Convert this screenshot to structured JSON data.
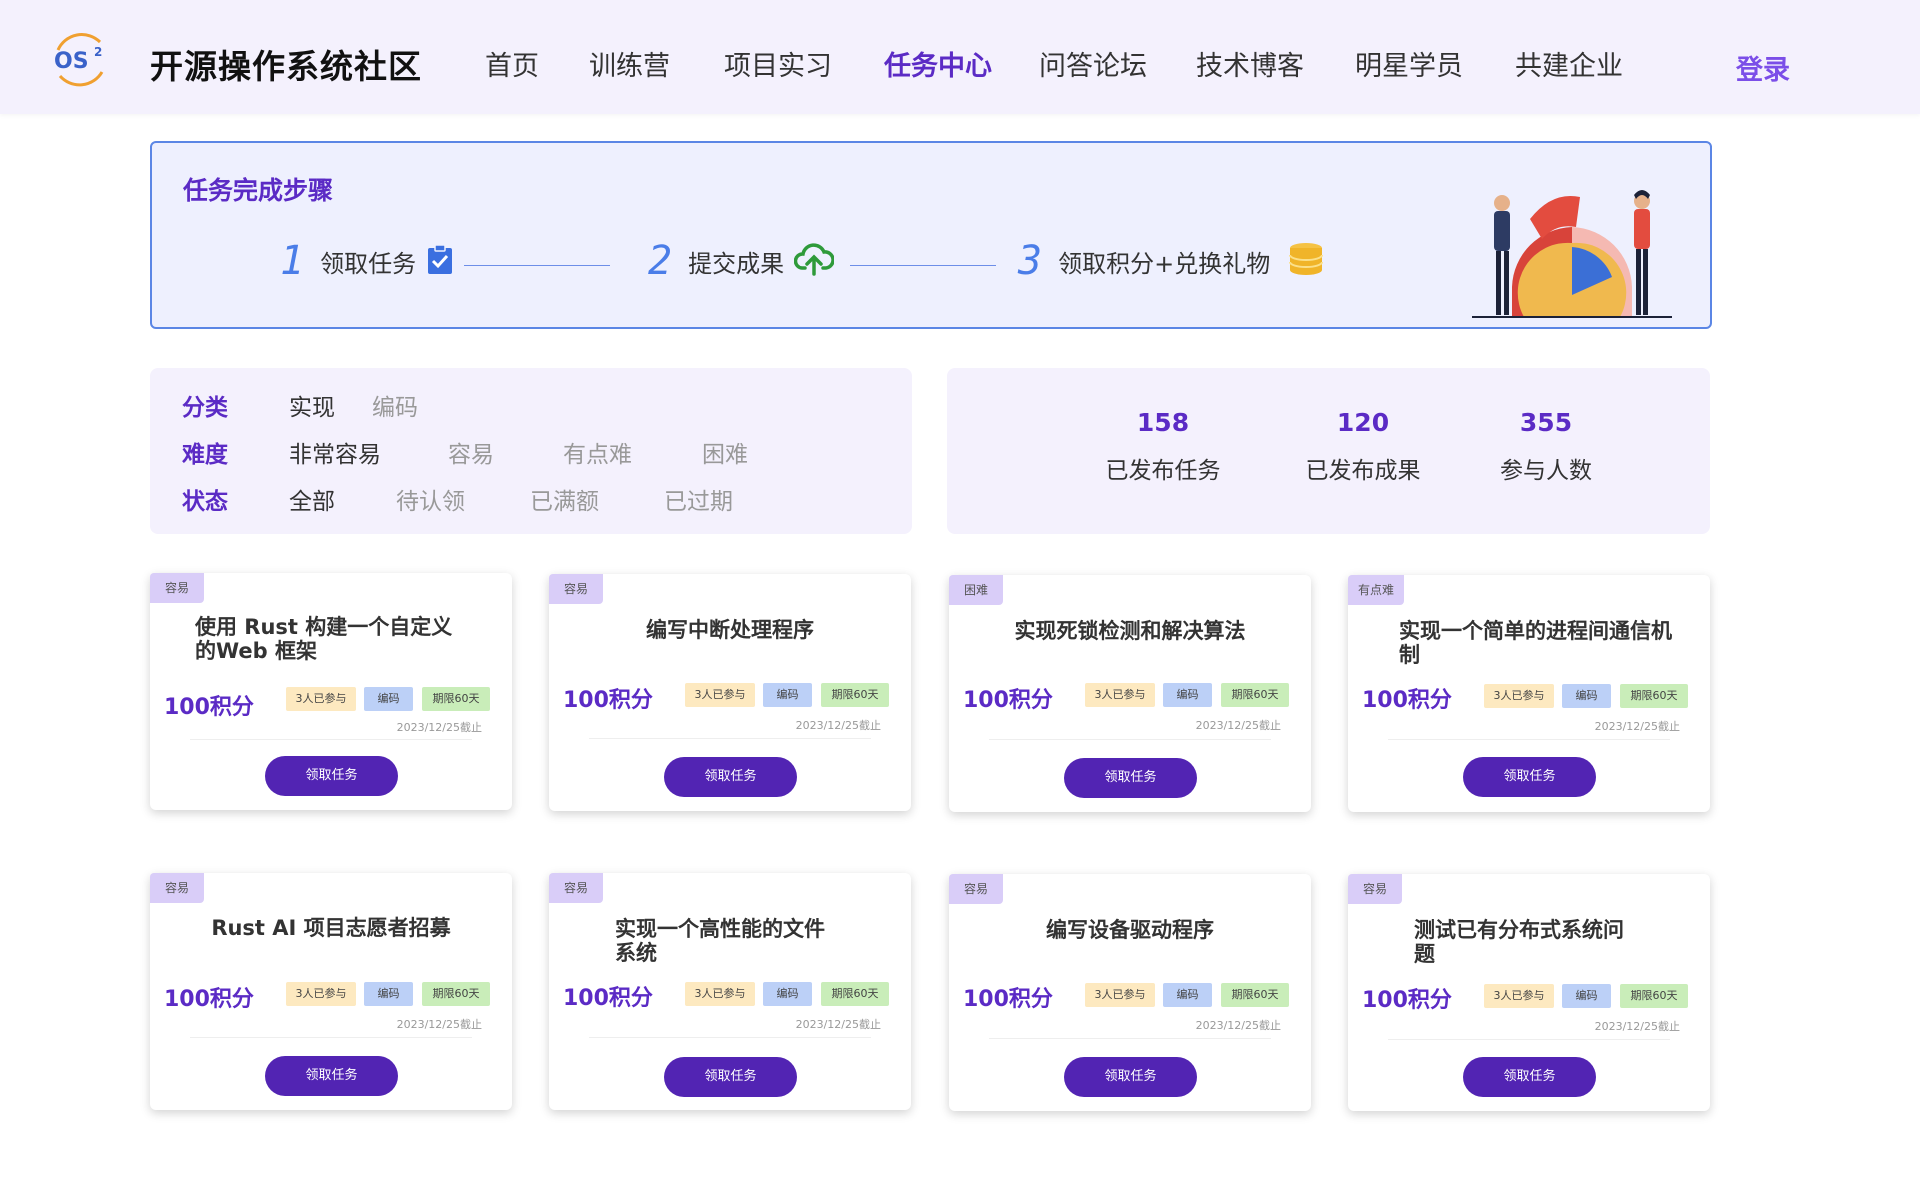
{
  "header": {
    "site_title": "开源操作系统社区",
    "logo_text": "OS²",
    "nav": [
      "首页",
      "训练营",
      "项目实习",
      "任务中心",
      "问答论坛",
      "技术博客",
      "明星学员",
      "共建企业"
    ],
    "active_nav": "任务中心",
    "login": "登录"
  },
  "steps": {
    "title": "任务完成步骤",
    "items": [
      {
        "num": "1",
        "label": "领取任务",
        "icon": "clipboard-check-icon"
      },
      {
        "num": "2",
        "label": "提交成果",
        "icon": "cloud-upload-icon"
      },
      {
        "num": "3",
        "label": "领取积分+兑换礼物",
        "icon": "coins-stack-icon"
      }
    ]
  },
  "filters": {
    "category": {
      "label": "分类",
      "options": [
        "实现",
        "编码"
      ],
      "selected": "实现"
    },
    "difficulty": {
      "label": "难度",
      "options": [
        "非常容易",
        "容易",
        "有点难",
        "困难"
      ],
      "selected": "非常容易"
    },
    "status": {
      "label": "状态",
      "options": [
        "全部",
        "待认领",
        "已满额",
        "已过期"
      ],
      "selected": "全部"
    }
  },
  "stats": [
    {
      "value": "158",
      "label": "已发布任务"
    },
    {
      "value": "120",
      "label": "已发布成果"
    },
    {
      "value": "355",
      "label": "参与人数"
    }
  ],
  "tasks": [
    {
      "difficulty": "容易",
      "title": "使用 Rust 构建一个自定义的Web 框架",
      "points": "100积分",
      "participants": "3人已参与",
      "type": "编码",
      "limit": "期限60天",
      "deadline": "2023/12/25截止",
      "button": "领取任务"
    },
    {
      "difficulty": "容易",
      "title": "编写中断处理程序",
      "points": "100积分",
      "participants": "3人已参与",
      "type": "编码",
      "limit": "期限60天",
      "deadline": "2023/12/25截止",
      "button": "领取任务"
    },
    {
      "difficulty": "困难",
      "title": "实现死锁检测和解决算法",
      "points": "100积分",
      "participants": "3人已参与",
      "type": "编码",
      "limit": "期限60天",
      "deadline": "2023/12/25截止",
      "button": "领取任务"
    },
    {
      "difficulty": "有点难",
      "title": "实现一个简单的进程间通信机制",
      "points": "100积分",
      "participants": "3人已参与",
      "type": "编码",
      "limit": "期限60天",
      "deadline": "2023/12/25截止",
      "button": "领取任务"
    },
    {
      "difficulty": "容易",
      "title": "Rust AI 项目志愿者招募",
      "points": "100积分",
      "participants": "3人已参与",
      "type": "编码",
      "limit": "期限60天",
      "deadline": "2023/12/25截止",
      "button": "领取任务"
    },
    {
      "difficulty": "容易",
      "title": "实现一个高性能的文件系统",
      "points": "100积分",
      "participants": "3人已参与",
      "type": "编码",
      "limit": "期限60天",
      "deadline": "2023/12/25截止",
      "button": "领取任务"
    },
    {
      "difficulty": "容易",
      "title": "编写设备驱动程序",
      "points": "100积分",
      "participants": "3人已参与",
      "type": "编码",
      "limit": "期限60天",
      "deadline": "2023/12/25截止",
      "button": "领取任务"
    },
    {
      "difficulty": "容易",
      "title": "测试已有分布式系统问题",
      "points": "100积分",
      "participants": "3人已参与",
      "type": "编码",
      "limit": "期限60天",
      "deadline": "2023/12/25截止",
      "button": "领取任务"
    }
  ],
  "colors": {
    "brand_purple": "#5b2bc5",
    "button_purple": "#5224b3",
    "step_blue": "#4a7de8",
    "upload_green": "#2e9a3a",
    "coin_gold": "#f0b429",
    "header_bg": "#f4f1fd",
    "banner_bg": "#eef0fe"
  }
}
